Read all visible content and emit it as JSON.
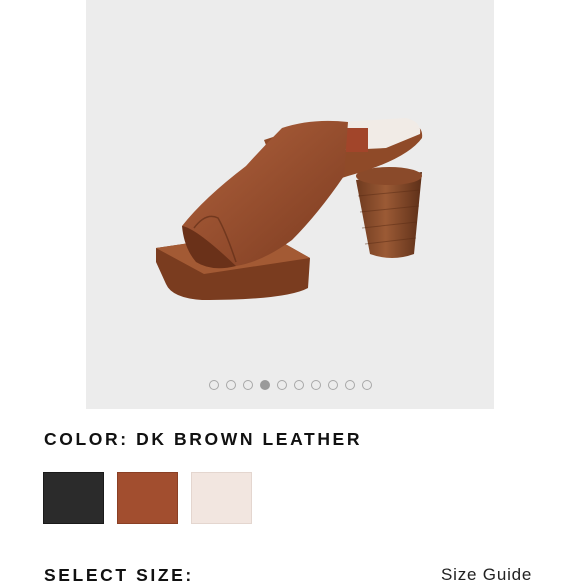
{
  "gallery": {
    "image_subject": "brown leather platform mule sandal",
    "dot_count": 10,
    "active_index": 3
  },
  "color": {
    "label": "COLOR: DK BROWN LEATHER",
    "swatches": [
      {
        "name": "black",
        "hex": "#2b2b2b"
      },
      {
        "name": "dk-brown",
        "hex": "#a24e2f"
      },
      {
        "name": "ivory",
        "hex": "#f2e6e0"
      }
    ],
    "selected": "dk-brown"
  },
  "size": {
    "label": "SELECT SIZE:",
    "guide_label": "Size Guide"
  }
}
